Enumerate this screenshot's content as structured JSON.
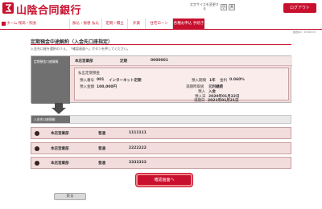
{
  "header": {
    "brand": "山陰合同銀行",
    "fontsize_label": "文字サイズを変更する",
    "small": "小",
    "large": "大",
    "logout": "ログアウト"
  },
  "nav": {
    "items": [
      {
        "label": "ホーム 残高・照会"
      },
      {
        "label": "振込・振替 払込"
      },
      {
        "label": "定期・積立"
      },
      {
        "label": "外貨"
      },
      {
        "label": "住宅ローン"
      },
      {
        "label": "各種お申込 手続き"
      }
    ]
  },
  "screen_id": "画面ID：BTD003",
  "page": {
    "title": "定期預金中途解約（入金先口座指定）",
    "instruction": "入金先口座を選択のうえ、「確認画面へ」ボタンを押してください。"
  },
  "source": {
    "label": "定期預金口座情報",
    "branch": "本店営業部",
    "type": "定期",
    "number": "0000001",
    "deposit_title": "払出定期預金",
    "deposit_no_label": "預入番号",
    "deposit_no": "001",
    "product": "インターネット定期",
    "amount_label": "預入金額",
    "amount": "100,000円",
    "period_label": "預入期間",
    "period": "1年",
    "rate_label": "金利",
    "rate": "0.060%",
    "method_label": "満期時取扱",
    "method": "元利継続",
    "kind_label": "預入",
    "kind": "入金",
    "start_label": "預入日",
    "start": "2020年01月22日",
    "maturity_label": "満期日",
    "maturity": "2021年01月21日"
  },
  "destination": {
    "label": "入金先口座情報",
    "rows": [
      {
        "branch": "本店営業部",
        "type": "普通",
        "number": "1111111"
      },
      {
        "branch": "本店営業部",
        "type": "普通",
        "number": "2222222"
      },
      {
        "branch": "本店営業部",
        "type": "普通",
        "number": "3333333"
      }
    ]
  },
  "buttons": {
    "confirm": "確認画面へ",
    "back": "戻る"
  },
  "colors": {
    "brand_red": "#c8102e",
    "row_pink": "#f2dcdc",
    "label_gray": "#707070"
  }
}
